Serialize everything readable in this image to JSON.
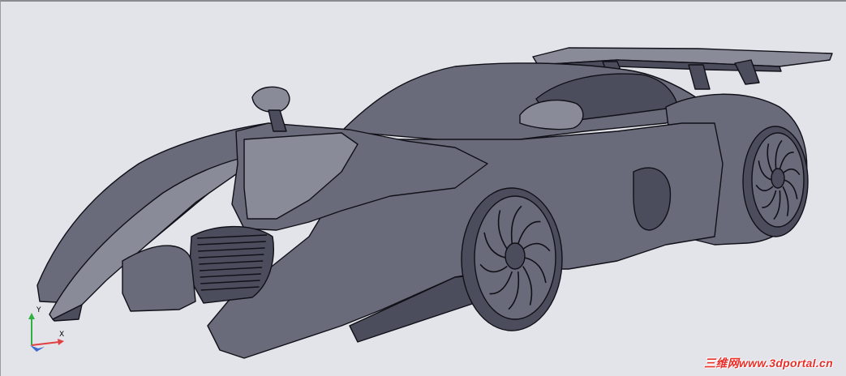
{
  "viewport": {
    "background": "#e3e3ea",
    "model_fill": "#6a6b7a",
    "model_dark": "#4c4d5c",
    "model_light": "#8a8b99",
    "edge_color": "#101018"
  },
  "ucs": {
    "x_label": "X",
    "y_label": "Y",
    "x_color": "#e04040",
    "y_color": "#30b040",
    "z_color": "#3a6ad0"
  },
  "watermark": {
    "text": "三维网www.3dportal.cn",
    "color": "#e8302a"
  }
}
